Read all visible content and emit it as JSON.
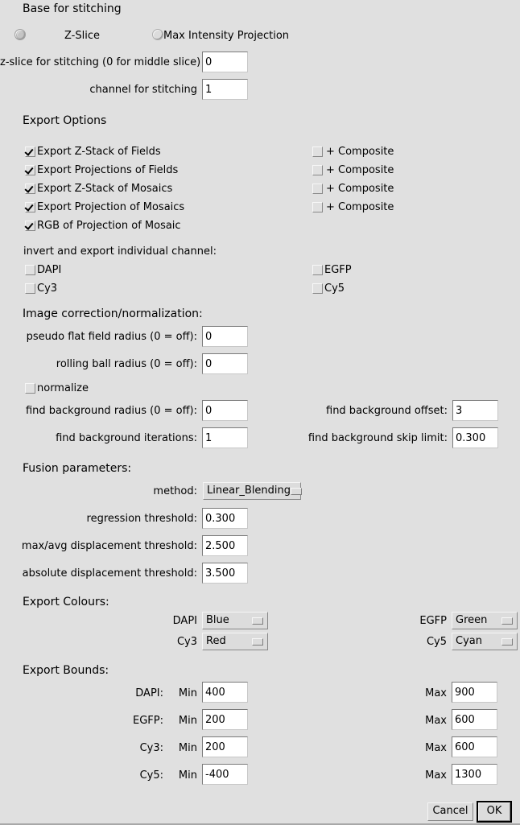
{
  "base_section": {
    "heading": "Base for stitching",
    "radio_options": [
      {
        "label": "Z-Slice",
        "selected": true
      },
      {
        "label": "Max Intensity Projection",
        "selected": false
      }
    ],
    "fields": [
      {
        "label": "z-slice for stitching (0 for middle slice)",
        "value": "0"
      },
      {
        "label": "channel for stitching",
        "value": "1"
      }
    ]
  },
  "export_options": {
    "heading": "Export Options",
    "rows": [
      {
        "label": "Export Z-Stack of Fields",
        "checked": true,
        "composite_label": "+ Composite",
        "composite_checked": false
      },
      {
        "label": "Export Projections of Fields",
        "checked": true,
        "composite_label": "+ Composite",
        "composite_checked": false
      },
      {
        "label": "Export Z-Stack of Mosaics",
        "checked": true,
        "composite_label": "+ Composite",
        "composite_checked": false
      },
      {
        "label": "Export Projection of Mosaics",
        "checked": true,
        "composite_label": "+ Composite",
        "composite_checked": false
      },
      {
        "label": "RGB of Projection of Mosaic",
        "checked": true,
        "composite_label": "",
        "composite_checked": false
      }
    ]
  },
  "invert_section": {
    "heading": "invert and export individual channel:",
    "channels": [
      {
        "label": "DAPI",
        "checked": false
      },
      {
        "label": "EGFP",
        "checked": false
      },
      {
        "label": "Cy3",
        "checked": false
      },
      {
        "label": "Cy5",
        "checked": false
      }
    ]
  },
  "correction": {
    "heading": "Image correction/normalization:",
    "pseudo_flat_label": "pseudo flat field radius (0 = off):",
    "pseudo_flat_value": "0",
    "rolling_ball_label": "rolling ball radius (0 = off):",
    "rolling_ball_value": "0",
    "normalize_label": "normalize",
    "normalize_checked": false,
    "bg_radius_label": "find background radius (0 = off):",
    "bg_radius_value": "0",
    "bg_offset_label": "find background offset:",
    "bg_offset_value": "3",
    "bg_iterations_label": "find background iterations:",
    "bg_iterations_value": "1",
    "bg_skip_label": "find background skip limit:",
    "bg_skip_value": "0.300"
  },
  "fusion": {
    "heading": "Fusion parameters:",
    "method_label": "method:",
    "method_value": "Linear_Blending",
    "regression_label": "regression threshold:",
    "regression_value": "0.300",
    "maxavg_label": "max/avg displacement threshold:",
    "maxavg_value": "2.500",
    "absolute_label": "absolute displacement threshold:",
    "absolute_value": "3.500"
  },
  "export_colours": {
    "heading": "Export Colours:",
    "items": [
      {
        "label": "DAPI",
        "value": "Blue"
      },
      {
        "label": "EGFP",
        "value": "Green"
      },
      {
        "label": "Cy3",
        "value": "Red"
      },
      {
        "label": "Cy5",
        "value": "Cyan"
      }
    ]
  },
  "export_bounds": {
    "heading": "Export Bounds:",
    "min_label": "Min",
    "max_label": "Max",
    "rows": [
      {
        "label": "DAPI:",
        "min": "400",
        "max": "900"
      },
      {
        "label": "EGFP:",
        "min": "200",
        "max": "600"
      },
      {
        "label": "Cy3:",
        "min": "200",
        "max": "600"
      },
      {
        "label": "Cy5:",
        "min": "-400",
        "max": "1300"
      }
    ]
  },
  "buttons": {
    "cancel": "Cancel",
    "ok": "OK"
  }
}
